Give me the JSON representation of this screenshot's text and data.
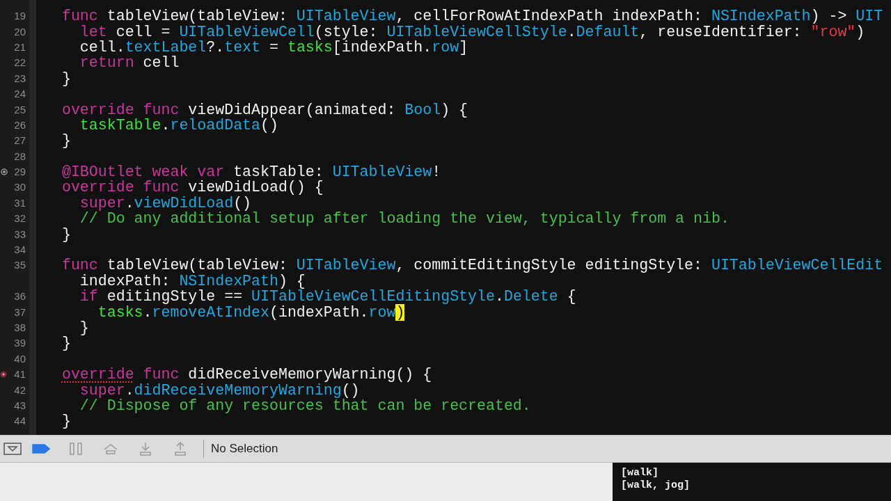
{
  "editor": {
    "lines": [
      {
        "kind": "code",
        "number": "19",
        "tokens": [
          {
            "kind": "keyword",
            "text": "  func"
          },
          {
            "kind": "plain",
            "text": " tableView(tableView: "
          },
          {
            "kind": "type",
            "text": "UITableView"
          },
          {
            "kind": "plain",
            "text": ", cellForRowAtIndexPath indexPath: "
          },
          {
            "kind": "type",
            "text": "NSIndexPath"
          },
          {
            "kind": "plain",
            "text": ") -> "
          },
          {
            "kind": "type",
            "text": "UIT"
          }
        ]
      },
      {
        "kind": "code",
        "number": "20",
        "tokens": [
          {
            "kind": "keyword",
            "text": "    let"
          },
          {
            "kind": "plain",
            "text": " cell = "
          },
          {
            "kind": "type",
            "text": "UITableViewCell"
          },
          {
            "kind": "plain",
            "text": "(style: "
          },
          {
            "kind": "type",
            "text": "UITableViewCellStyle"
          },
          {
            "kind": "plain",
            "text": "."
          },
          {
            "kind": "type",
            "text": "Default"
          },
          {
            "kind": "plain",
            "text": ", reuseIdentifier: "
          },
          {
            "kind": "string",
            "text": "\"row\""
          },
          {
            "kind": "plain",
            "text": ")"
          }
        ]
      },
      {
        "kind": "code",
        "number": "21",
        "tokens": [
          {
            "kind": "plain",
            "text": "    cell."
          },
          {
            "kind": "type",
            "text": "textLabel"
          },
          {
            "kind": "plain",
            "text": "?."
          },
          {
            "kind": "type",
            "text": "text"
          },
          {
            "kind": "plain",
            "text": " = "
          },
          {
            "kind": "project",
            "text": "tasks"
          },
          {
            "kind": "plain",
            "text": "[indexPath."
          },
          {
            "kind": "type",
            "text": "row"
          },
          {
            "kind": "plain",
            "text": "]"
          }
        ]
      },
      {
        "kind": "code",
        "number": "22",
        "tokens": [
          {
            "kind": "keyword",
            "text": "    return"
          },
          {
            "kind": "plain",
            "text": " cell"
          }
        ]
      },
      {
        "kind": "code",
        "number": "23",
        "tokens": [
          {
            "kind": "plain",
            "text": "  }"
          }
        ]
      },
      {
        "kind": "code",
        "number": "24"
      },
      {
        "kind": "code",
        "number": "25",
        "tokens": [
          {
            "kind": "keyword",
            "text": "  override func"
          },
          {
            "kind": "plain",
            "text": " viewDidAppear(animated: "
          },
          {
            "kind": "type",
            "text": "Bool"
          },
          {
            "kind": "plain",
            "text": ") {"
          }
        ]
      },
      {
        "kind": "code",
        "number": "26",
        "tokens": [
          {
            "kind": "project",
            "text": "    taskTable"
          },
          {
            "kind": "plain",
            "text": "."
          },
          {
            "kind": "type",
            "text": "reloadData"
          },
          {
            "kind": "plain",
            "text": "()"
          }
        ]
      },
      {
        "kind": "code",
        "number": "27",
        "tokens": [
          {
            "kind": "plain",
            "text": "  }"
          }
        ]
      },
      {
        "kind": "code",
        "number": "28"
      },
      {
        "kind": "outlet",
        "number": "29",
        "tokens": [
          {
            "kind": "keyword",
            "text": "  @IBOutlet weak var"
          },
          {
            "kind": "plain",
            "text": " taskTable: "
          },
          {
            "kind": "type",
            "text": "UITableView"
          },
          {
            "kind": "plain",
            "text": "!"
          }
        ]
      },
      {
        "kind": "code",
        "number": "30",
        "tokens": [
          {
            "kind": "keyword",
            "text": "  override func"
          },
          {
            "kind": "plain",
            "text": " viewDidLoad() {"
          }
        ]
      },
      {
        "kind": "code",
        "number": "31",
        "tokens": [
          {
            "kind": "keyword",
            "text": "    super"
          },
          {
            "kind": "plain",
            "text": "."
          },
          {
            "kind": "type",
            "text": "viewDidLoad"
          },
          {
            "kind": "plain",
            "text": "()"
          }
        ]
      },
      {
        "kind": "code",
        "number": "32",
        "tokens": [
          {
            "kind": "comment",
            "text": "    // Do any additional setup after loading the view, typically from a nib."
          }
        ]
      },
      {
        "kind": "code",
        "number": "33",
        "tokens": [
          {
            "kind": "plain",
            "text": "  }"
          }
        ]
      },
      {
        "kind": "code",
        "number": "34"
      },
      {
        "kind": "code",
        "number": "35",
        "tokens": [
          {
            "kind": "keyword",
            "text": "  func"
          },
          {
            "kind": "plain",
            "text": " tableView(tableView: "
          },
          {
            "kind": "type",
            "text": "UITableView"
          },
          {
            "kind": "plain",
            "text": ", commitEditingStyle editingStyle: "
          },
          {
            "kind": "type",
            "text": "UITableViewCellEdit"
          }
        ]
      },
      {
        "kind": "code",
        "tokens": [
          {
            "kind": "plain",
            "text": "    indexPath: "
          },
          {
            "kind": "type",
            "text": "NSIndexPath"
          },
          {
            "kind": "plain",
            "text": ") {"
          }
        ]
      },
      {
        "kind": "code",
        "number": "36",
        "tokens": [
          {
            "kind": "keyword",
            "text": "    if"
          },
          {
            "kind": "plain",
            "text": " editingStyle == "
          },
          {
            "kind": "type",
            "text": "UITableViewCellEditingStyle"
          },
          {
            "kind": "plain",
            "text": "."
          },
          {
            "kind": "type",
            "text": "Delete"
          },
          {
            "kind": "plain",
            "text": " {"
          }
        ]
      },
      {
        "kind": "code",
        "number": "37",
        "tokens": [
          {
            "kind": "project",
            "text": "      tasks"
          },
          {
            "kind": "plain",
            "text": "."
          },
          {
            "kind": "type",
            "text": "removeAtIndex"
          },
          {
            "kind": "plain",
            "text": "(indexPath."
          },
          {
            "kind": "type",
            "text": "row"
          },
          {
            "kind": "highlight",
            "text": ")"
          }
        ]
      },
      {
        "kind": "code",
        "number": "38",
        "tokens": [
          {
            "kind": "plain",
            "text": "    }"
          }
        ]
      },
      {
        "kind": "code",
        "number": "39",
        "tokens": [
          {
            "kind": "plain",
            "text": "  }"
          }
        ]
      },
      {
        "kind": "code",
        "number": "40"
      },
      {
        "kind": "issue",
        "number": "41",
        "tokens": [
          {
            "kind": "keyword_warning",
            "text": "  override"
          },
          {
            "kind": "keyword",
            "text": " func"
          },
          {
            "kind": "plain",
            "text": " didReceiveMemoryWarning() {"
          }
        ]
      },
      {
        "kind": "code",
        "number": "42",
        "tokens": [
          {
            "kind": "keyword",
            "text": "    super"
          },
          {
            "kind": "plain",
            "text": "."
          },
          {
            "kind": "type",
            "text": "didReceiveMemoryWarning"
          },
          {
            "kind": "plain",
            "text": "()"
          }
        ]
      },
      {
        "kind": "code",
        "number": "43",
        "tokens": [
          {
            "kind": "comment",
            "text": "    // Dispose of any resources that can be recreated."
          }
        ]
      },
      {
        "kind": "code",
        "number": "44",
        "tokens": [
          {
            "kind": "plain",
            "text": "  }"
          }
        ]
      }
    ]
  },
  "debug_bar": {
    "buttons": [
      {
        "kind": "hide-panel"
      },
      {
        "kind": "breakpoints",
        "on": true
      },
      {
        "kind": "pause"
      },
      {
        "kind": "step-over"
      },
      {
        "kind": "step-in"
      },
      {
        "kind": "step-out"
      }
    ],
    "selection": "No Selection"
  },
  "console": {
    "lines": [
      "[walk]",
      "[walk, jog]"
    ]
  }
}
